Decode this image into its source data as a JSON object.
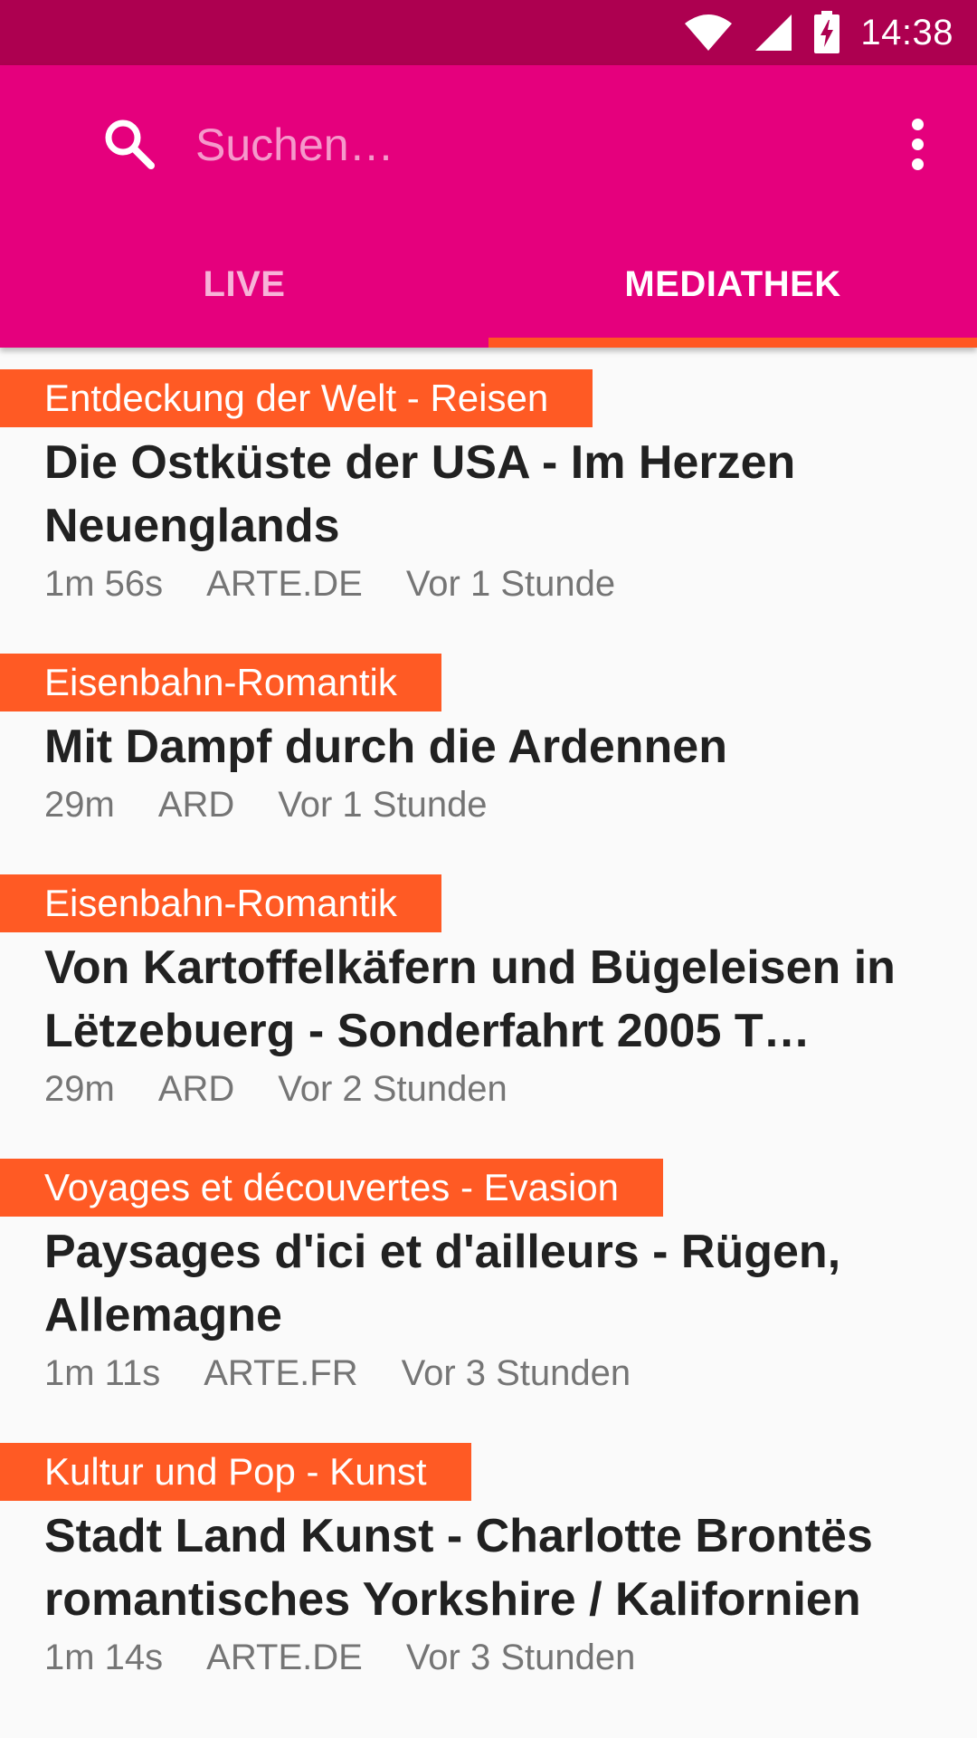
{
  "status_bar": {
    "time": "14:38",
    "icons": [
      "wifi-icon",
      "signal-icon",
      "battery-charging-icon"
    ]
  },
  "app_bar": {
    "search": {
      "placeholder": "Suchen…",
      "value": ""
    },
    "overflow_icon": "more-vert-icon",
    "tabs": [
      {
        "label": "LIVE",
        "active": false
      },
      {
        "label": "MEDIATHEK",
        "active": true
      }
    ]
  },
  "colors": {
    "status_bar": "#ad0050",
    "app_bar": "#e5007d",
    "tab_indicator": "#ff5722",
    "topic_badge": "#ff5a24",
    "background": "#fafafa"
  },
  "items": [
    {
      "topic": "Entdeckung der Welt - Reisen",
      "title": "Die Ostküste der USA - Im Herzen Neuenglands",
      "duration": "1m 56s",
      "channel": "ARTE.DE",
      "time": "Vor 1 Stunde"
    },
    {
      "topic": "Eisenbahn-Romantik",
      "title": "Mit Dampf durch die Ardennen",
      "duration": "29m",
      "channel": "ARD",
      "time": "Vor 1 Stunde"
    },
    {
      "topic": "Eisenbahn-Romantik",
      "title": "Von Kartoffelkäfern und Bügeleisen in Lëtzebuerg - Sonderfahrt 2005 T…",
      "duration": "29m",
      "channel": "ARD",
      "time": "Vor 2 Stunden"
    },
    {
      "topic": "Voyages et découvertes - Evasion",
      "title": "Paysages d'ici et d'ailleurs - Rügen, Allemagne",
      "duration": "1m 11s",
      "channel": "ARTE.FR",
      "time": "Vor 3 Stunden"
    },
    {
      "topic": "Kultur und Pop - Kunst",
      "title": "Stadt Land Kunst - Charlotte Brontës romantisches Yorkshire / Kalifornien",
      "duration": "1m 14s",
      "channel": "ARTE.DE",
      "time": "Vor 3 Stunden"
    }
  ]
}
